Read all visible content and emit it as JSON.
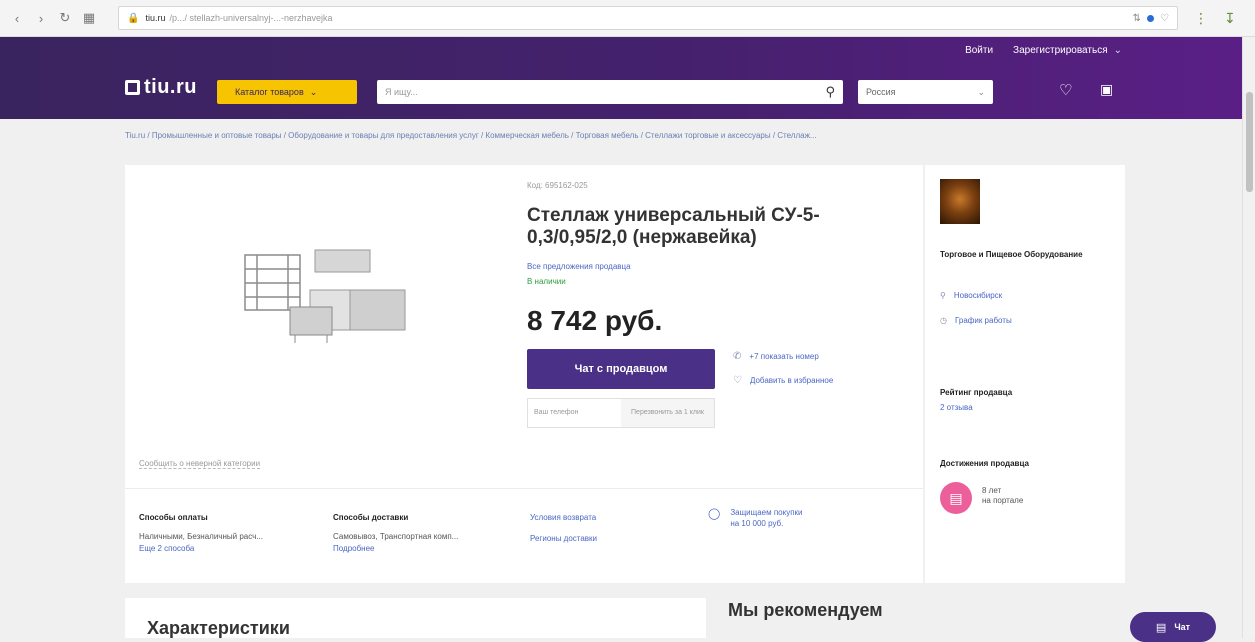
{
  "browser": {
    "url_host": "tiu.ru",
    "url_path": "/p.../ stellazh-universalnyj-...-nerzhavejka"
  },
  "header": {
    "login": "Войти",
    "register": "Зарегистрироваться",
    "logo_text": "tiu.ru",
    "catalog_label": "Каталог товаров",
    "search_placeholder": "Я ищу...",
    "region_value": "Россия",
    "brand_color": "#45216d",
    "accent_color": "#f6c400"
  },
  "breadcrumb": "Tiu.ru / Промышленные и оптовые товары / Оборудование и товары для предоставления услуг / Коммерческая мебель / Торговая мебель / Стеллажи торговые и аксессуары / Стеллаж...",
  "product": {
    "code_label": "Код: 695162-025",
    "title": "Стеллаж универсальный СУ-5-0,3/0,95/2,0 (нержавейка)",
    "all_offers": "Все предложения продавца",
    "stock": "В наличии",
    "price": "8 742 руб.",
    "chat_button": "Чат с продавцом",
    "phone_placeholder": "Ваш телефон",
    "call_button": "Перезвонить за 1 клик",
    "show_phone": "+7 показать номер",
    "add_favorite": "Добавить в избранное",
    "report_wrong_category": "Сообщить о неверной категории"
  },
  "info": {
    "payment_title": "Способы оплаты",
    "payment_value": "Наличными, Безналичный расч...",
    "payment_more": "Еще 2 способа",
    "delivery_title": "Способы доставки",
    "delivery_value": "Самовывоз, Транспортная комп...",
    "delivery_more": "Подробнее",
    "return_terms": "Условия возврата",
    "delivery_regions": "Регионы доставки",
    "protection_line1": "Защищаем покупки",
    "protection_line2": "на 10 000 руб."
  },
  "seller": {
    "name": "Торговое и Пищевое Оборудование",
    "city": "Новосибирск",
    "schedule": "График работы",
    "rating_title": "Рейтинг продавца",
    "reviews": "2 отзыва",
    "achievements_title": "Достижения продавца",
    "achievement_line1": "8 лет",
    "achievement_line2": "на портале"
  },
  "lower": {
    "characteristics": "Характеристики",
    "recommend": "Мы рекомендуем",
    "chat_float": "Чат"
  }
}
